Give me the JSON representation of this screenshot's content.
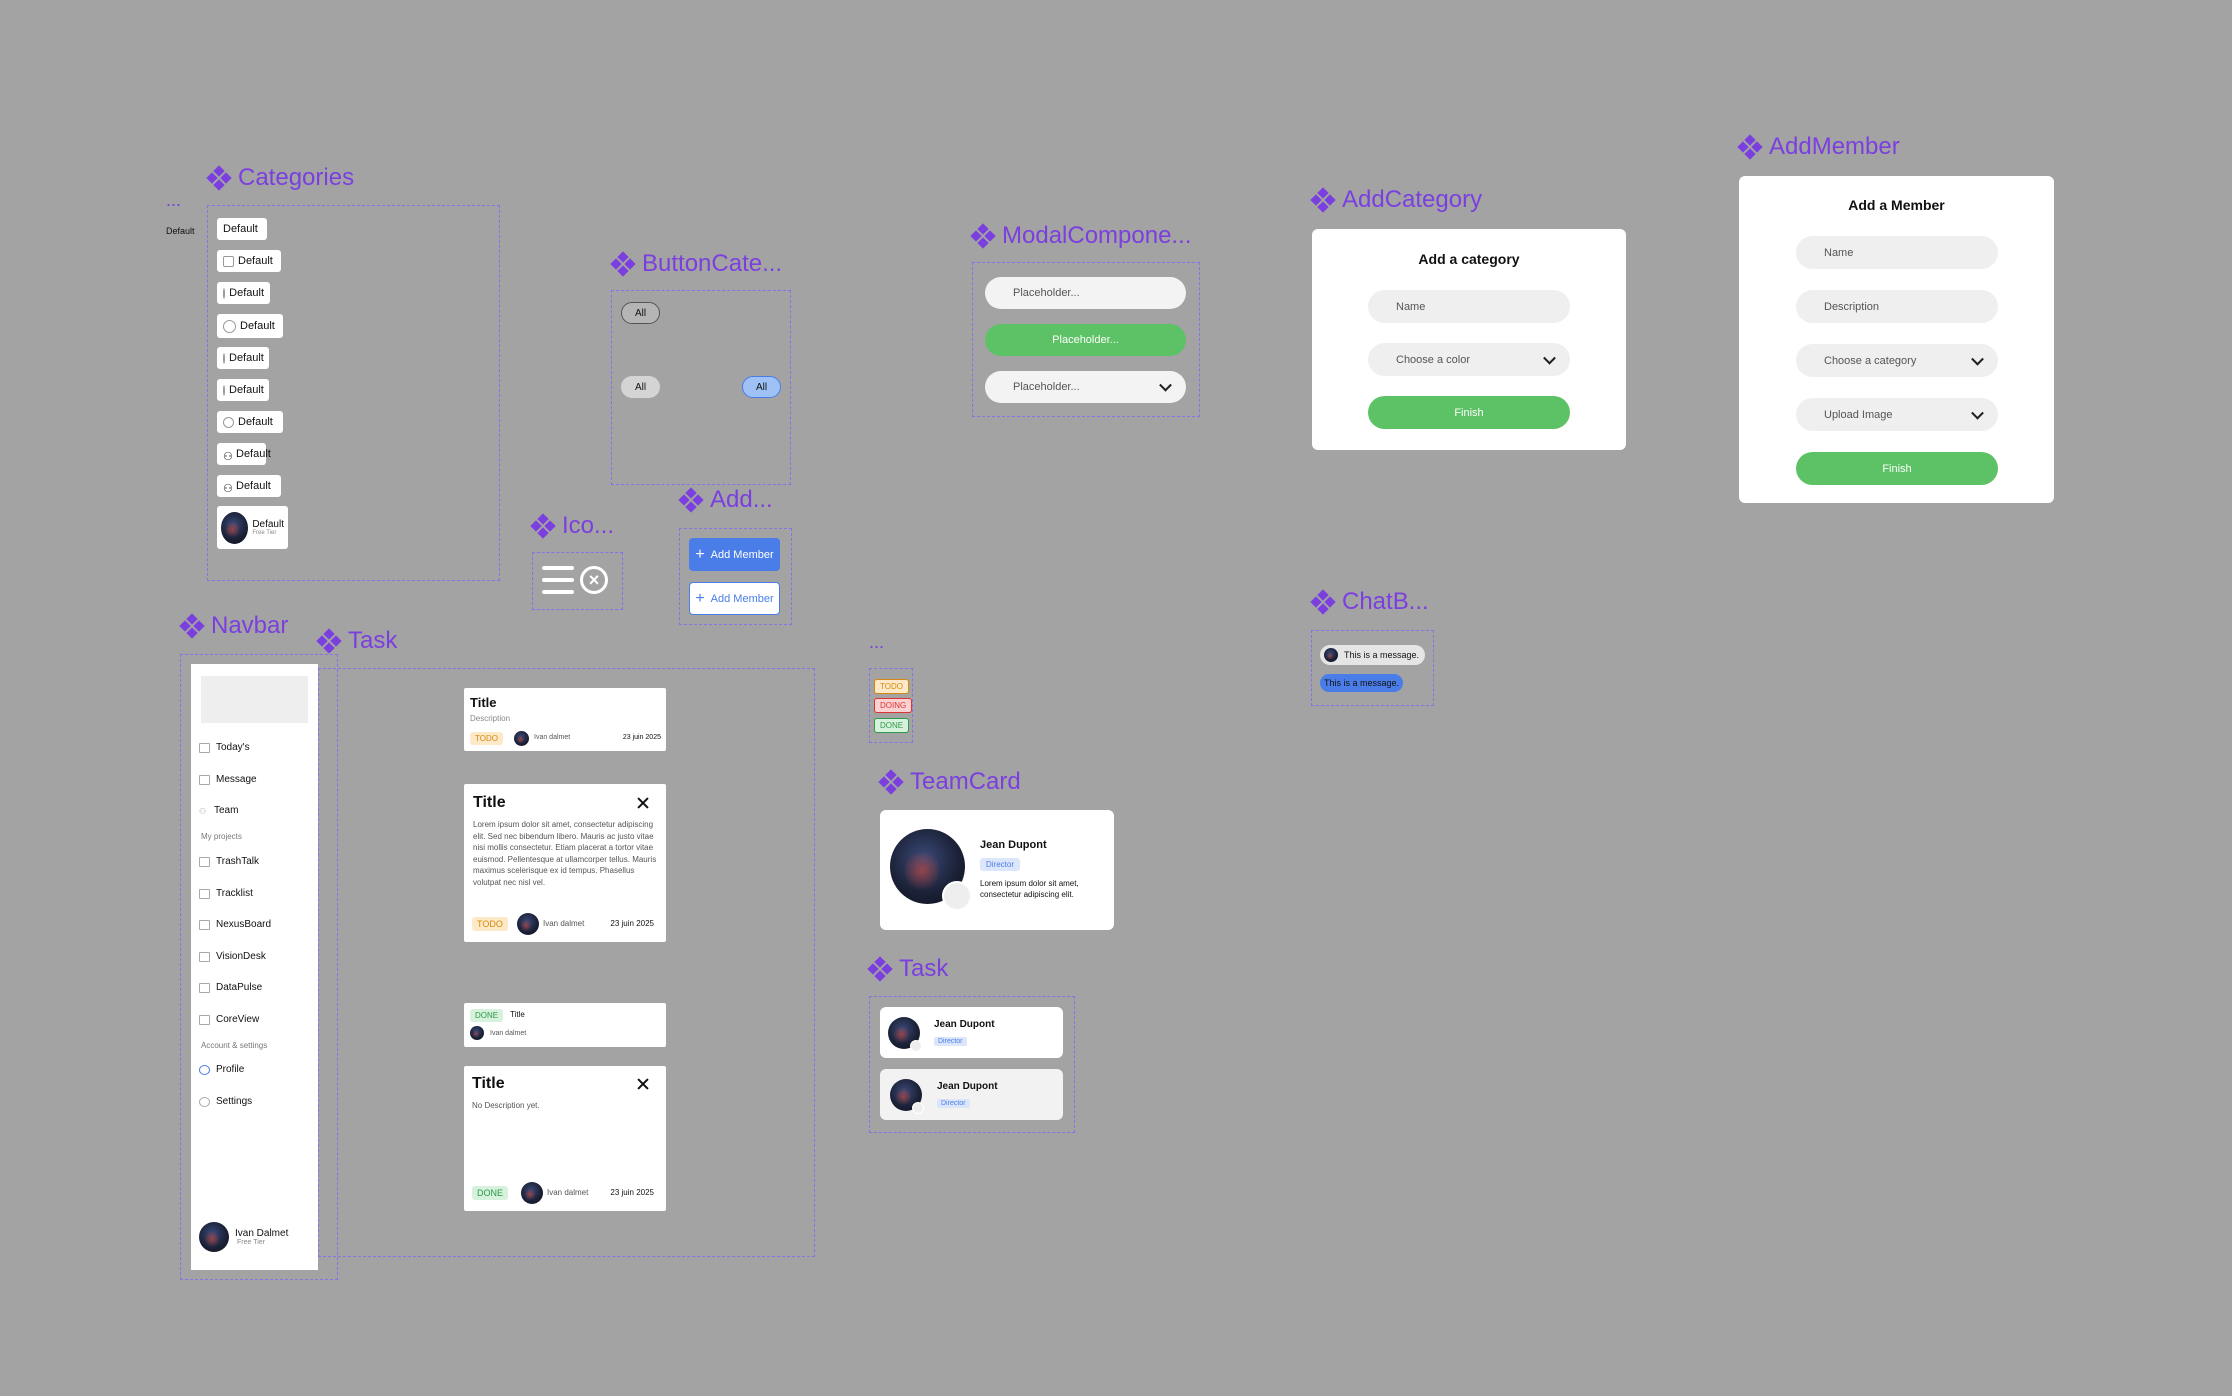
{
  "frames": {
    "dots_top": "...",
    "dots_mid": "...",
    "categories": "Categories",
    "button_cate": "ButtonCate...",
    "modal_compo": "ModalCompone...",
    "add_category": "AddCategory",
    "add_member": "AddMember",
    "ico": "Ico...",
    "add": "Add...",
    "navbar": "Navbar",
    "task_main": "Task",
    "teamcard": "TeamCard",
    "task_small": "Task",
    "chatb": "ChatB..."
  },
  "default_label": "Default",
  "categories": {
    "items": [
      "Default",
      "Default",
      "Default",
      "Default",
      "Default",
      "Default",
      "Default",
      "Default",
      "Default"
    ],
    "profile": {
      "name": "Default",
      "tier": "Free Tier"
    }
  },
  "button_cate": {
    "all1": "All",
    "all2": "All",
    "all3": "All"
  },
  "add_buttons": {
    "primary": "Add Member",
    "secondary": "Add Member"
  },
  "modal": {
    "placeholder1": "Placeholder...",
    "button": "Placeholder...",
    "select": "Placeholder..."
  },
  "add_category": {
    "title": "Add a category",
    "name": "Name",
    "color": "Choose a color",
    "finish": "Finish"
  },
  "add_member": {
    "title": "Add a Member",
    "name": "Name",
    "description": "Description",
    "category": "Choose a category",
    "upload": "Upload Image",
    "finish": "Finish"
  },
  "navbar": {
    "items": [
      "Today's",
      "Message",
      "Team"
    ],
    "projects_header": "My projects",
    "projects": [
      "TrashTalk",
      "Tracklist",
      "NexusBoard",
      "VisionDesk",
      "DataPulse",
      "CoreView"
    ],
    "account_header": "Account & settings",
    "account": [
      "Profile",
      "Settings"
    ],
    "user": {
      "name": "Ivan Dalmet",
      "tier": "Free Tier"
    }
  },
  "tasks": {
    "t1": {
      "title": "Title",
      "desc": "Description",
      "status": "TODO",
      "user": "Ivan dalmet",
      "date": "23 juin 2025"
    },
    "t2": {
      "title": "Title",
      "desc": "Lorem ipsum dolor sit amet, consectetur adipiscing elit. Sed nec bibendum libero. Mauris ac justo vitae nisi mollis consectetur. Etiam placerat a tortor vitae euismod. Pellentesque at ullamcorper tellus. Mauris maximus scelerisque ex id tempus. Phasellus volutpat nec nisl vel.",
      "status": "TODO",
      "user": "Ivan dalmet",
      "date": "23 juin 2025"
    },
    "t3": {
      "status": "DONE",
      "title": "Title",
      "user": "Ivan dalmet"
    },
    "t4": {
      "title": "Title",
      "desc": "No Description yet.",
      "status": "DONE",
      "user": "Ivan dalmet",
      "date": "23 juin 2025"
    }
  },
  "statuses": [
    "TODO",
    "DOING",
    "DONE"
  ],
  "teamcard": {
    "name": "Jean Dupont",
    "role": "Director",
    "desc": "Lorem ipsum dolor sit amet, consectetur adipiscing elit."
  },
  "task_members": [
    {
      "name": "Jean Dupont",
      "role": "Director"
    },
    {
      "name": "Jean Dupont",
      "role": "Director"
    }
  ],
  "chat": {
    "msg1": "This is a message.",
    "msg2": "This is a message."
  },
  "colors": {
    "accent": "#7b3fe0",
    "green": "#5dc165",
    "blue": "#4a7de8",
    "background": "#a3a3a3"
  }
}
